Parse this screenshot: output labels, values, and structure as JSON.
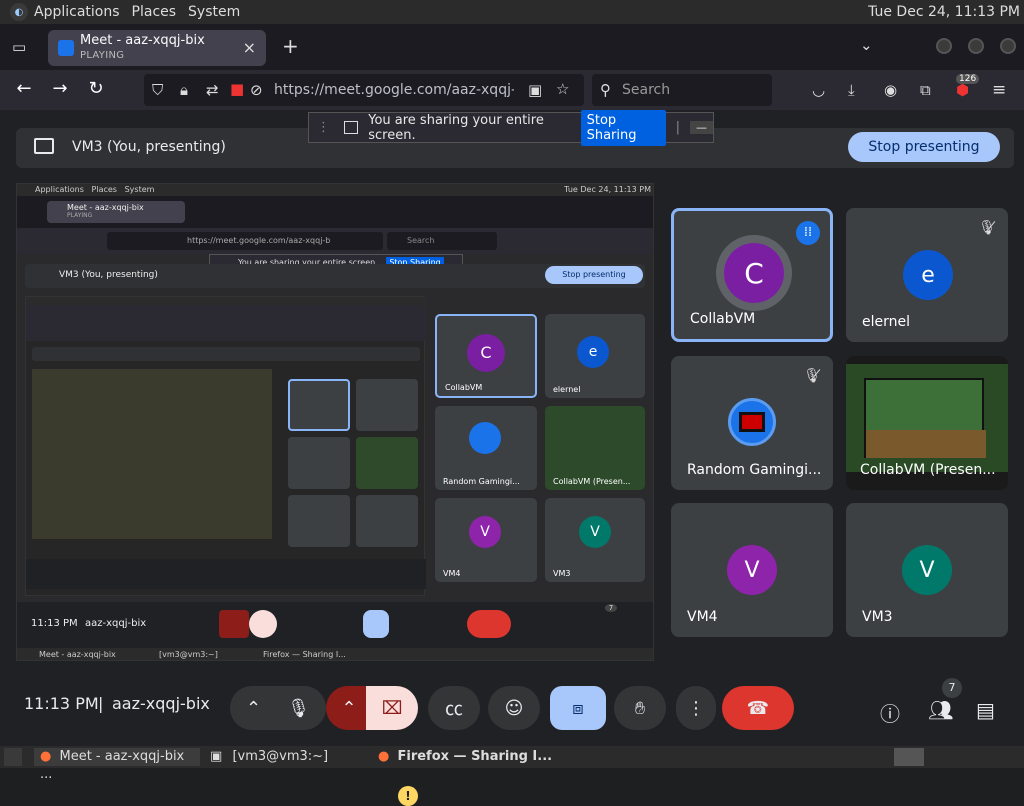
{
  "panel": {
    "applications": "Applications",
    "places": "Places",
    "system": "System",
    "clock": "Tue Dec 24, 11:13 PM"
  },
  "tab": {
    "title": "Meet - aaz-xqqj-bix",
    "status": "PLAYING",
    "close": "×",
    "new": "+"
  },
  "nav": {
    "url": "https://meet.google.com/aaz-xqqj-bix",
    "search_placeholder": "Search",
    "badge": "126"
  },
  "sharing": {
    "text": "You are sharing your entire screen.",
    "stop": "Stop Sharing",
    "min": "—"
  },
  "present": {
    "label": "VM3 (You, presenting)",
    "stop": "Stop presenting"
  },
  "participants": [
    {
      "name": "CollabVM",
      "initial": "C",
      "color": "#7b1fa2"
    },
    {
      "name": "elernel",
      "initial": "e",
      "color": "#0b57d0"
    },
    {
      "name": "Random Gamingi...",
      "initial": "",
      "color": "#1a73e8"
    },
    {
      "name": "CollabVM (Presen...",
      "initial": "",
      "color": "#000000"
    },
    {
      "name": "VM4",
      "initial": "V",
      "color": "#8e24aa"
    },
    {
      "name": "VM3",
      "initial": "V",
      "color": "#00796b"
    }
  ],
  "inner": {
    "panel_apps": "Applications",
    "panel_places": "Places",
    "panel_system": "System",
    "clock": "Tue Dec 24, 11:13 PM",
    "tab": "Meet - aaz-xqqj-bix",
    "tab_status": "PLAYING",
    "url": "https://meet.google.com/aaz-xqqj-b",
    "search": "Search",
    "share_text": "You are sharing your entire screen.",
    "stop_share": "Stop Sharing",
    "present": "VM3 (You, presenting)",
    "stop_present": "Stop presenting",
    "p1": "CollabVM",
    "p2": "elernel",
    "p3": "Random Gamingi...",
    "p4": "CollabVM (Presen...",
    "p5": "VM4",
    "p6": "VM3",
    "i1": "C",
    "i2": "e",
    "i5": "V",
    "i6": "V",
    "time": "11:13 PM",
    "code": "aaz-xqqj-bix",
    "count": "7",
    "task1": "Meet - aaz-xqqj-bix",
    "task2": "[vm3@vm3:~]",
    "task3": "Firefox — Sharing I..."
  },
  "meeting": {
    "time": "11:13 PM",
    "separator": "|",
    "code": "aaz-xqqj-bix",
    "people_count": "7",
    "warn": "!"
  },
  "taskbar": {
    "item1": "Meet - aaz-xqqj-bix ...",
    "item2": "[vm3@vm3:~]",
    "item3": "Firefox — Sharing I..."
  }
}
